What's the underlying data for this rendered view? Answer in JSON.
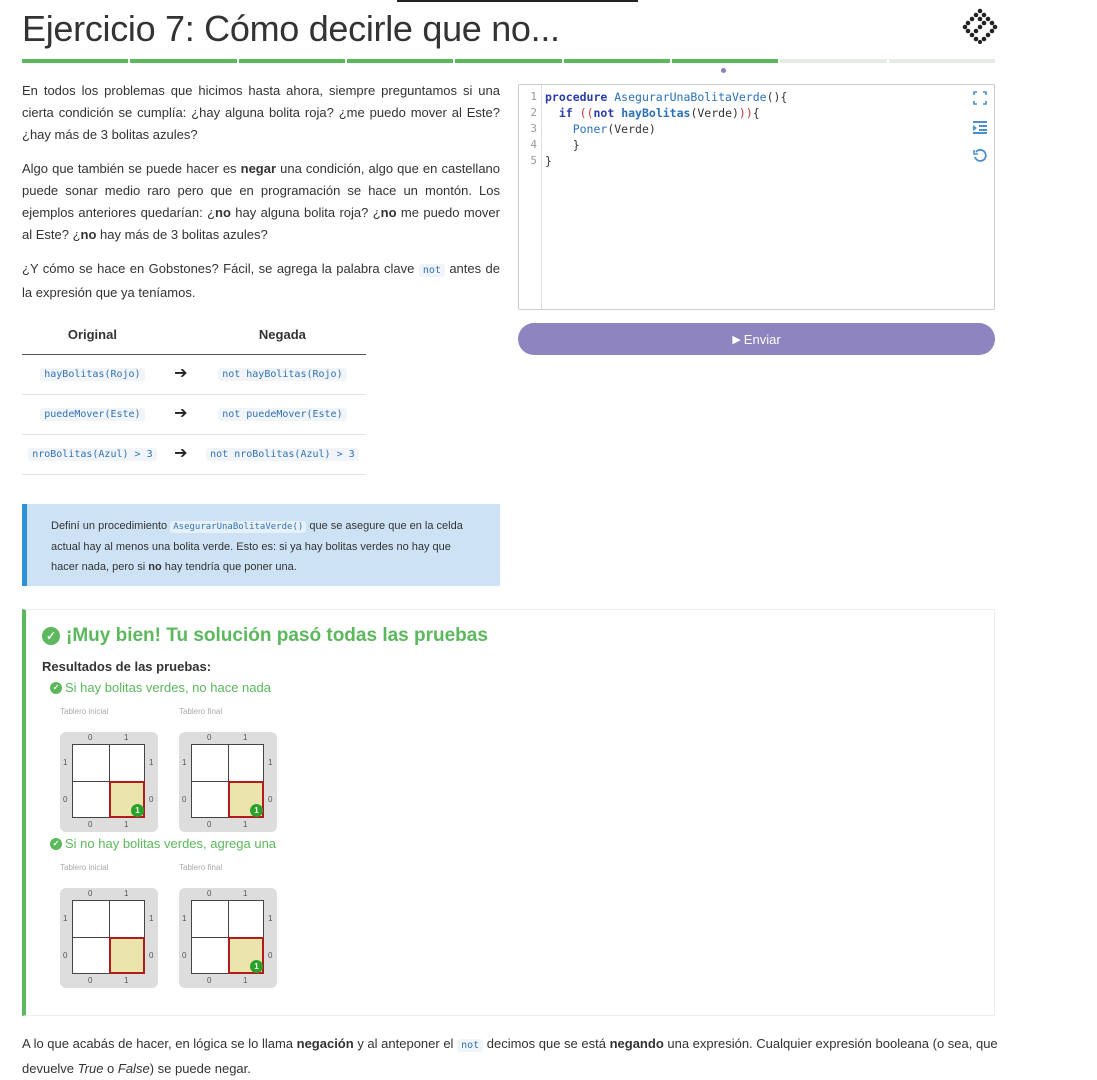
{
  "header": {
    "title": "Ejercicio 7: Cómo decirle que no...",
    "progress_done": 7,
    "progress_total": 9
  },
  "intro": {
    "p1": "En todos los problemas que hicimos hasta ahora, siempre preguntamos si una cierta condición se cumplía: ¿hay alguna bolita roja? ¿me puedo mover al Este? ¿hay más de 3 bolitas azules?",
    "p2_a": "Algo que también se puede hacer es ",
    "p2_bold": "negar",
    "p2_b": " una condición, algo que en castellano puede sonar medio raro pero que en programación se hace un montón. Los ejemplos anteriores quedarían: ¿",
    "p2_no1": "no",
    "p2_c": " hay alguna bolita roja? ¿",
    "p2_no2": "no",
    "p2_d": " me puedo mover al Este? ¿",
    "p2_no3": "no",
    "p2_e": " hay más de 3 bolitas azules?",
    "p3_a": "¿Y cómo se hace en Gobstones? Fácil, se agrega la palabra clave ",
    "p3_code": "not",
    "p3_b": " antes de la expresión que ya teníamos."
  },
  "table": {
    "headers": [
      "Original",
      "Negada"
    ],
    "arrow": "➔",
    "rows": [
      {
        "original": "hayBolitas(Rojo)",
        "negada": "not hayBolitas(Rojo)"
      },
      {
        "original": "puedeMover(Este)",
        "negada": "not puedeMover(Este)"
      },
      {
        "original": "nroBolitas(Azul) > 3",
        "negada": "not nroBolitas(Azul) > 3"
      }
    ]
  },
  "task": {
    "a": "Definí un procedimiento ",
    "code": "AsegurarUnaBolitaVerde()",
    "b": " que se asegure que en la celda actual hay al menos una bolita verde. Esto es: si ya hay bolitas verdes no hay que hacer nada, pero si ",
    "bold": "no",
    "c": " hay tendría que poner una."
  },
  "editor": {
    "line_numbers": [
      "1",
      "2",
      "3",
      "4",
      "5"
    ],
    "code": {
      "l1_kw": "procedure",
      "l1_fn": "AsegurarUnaBolitaVerde",
      "l1_rest": "(){",
      "l2_indent": "  ",
      "l2_kw": "if",
      "l2_b1": " ((",
      "l2_not": "not",
      "l2_fn": " hayBolitas",
      "l2_rest": "(Verde)",
      "l2_b2": "))",
      "l2_end": "{",
      "l3_indent": "    ",
      "l3_fn": "Poner",
      "l3_rest": "(Verde)",
      "l4": "    }",
      "l5": "}"
    },
    "icons": [
      "fullscreen-icon",
      "indent-icon",
      "reset-icon"
    ]
  },
  "send_button": {
    "icon": "▶",
    "label": "Enviar"
  },
  "results": {
    "title": "¡Muy bien! Tu solución pasó todas las pruebas",
    "subtitle": "Resultados de las pruebas:",
    "tests": [
      {
        "name": "Si hay bolitas verdes, no hace nada",
        "initial_label": "Tablero inicial",
        "final_label": "Tablero final",
        "initial_green": "1",
        "final_green": "1"
      },
      {
        "name": "Si no hay bolitas verdes, agrega una",
        "initial_label": "Tablero inicial",
        "final_label": "Tablero final",
        "initial_green": null,
        "final_green": "1"
      }
    ],
    "axis": {
      "x": [
        "0",
        "1"
      ],
      "y": [
        "1",
        "0"
      ]
    },
    "check_glyph": "✓",
    "colors": {
      "success": "#5cb85c",
      "ball": "#2aa22a",
      "head": "#b01c1c"
    }
  },
  "footer": {
    "a": "A lo que acabás de hacer, en lógica se lo llama ",
    "bold1": "negación",
    "b": " y al anteponer el ",
    "code": "not",
    "c": " decimos que se está ",
    "bold2": "negando",
    "d": " una expresión. Cualquier expresión booleana (o sea, que devuelve ",
    "i1": "True",
    "e": " o ",
    "i2": "False",
    "f": ") se puede negar."
  }
}
